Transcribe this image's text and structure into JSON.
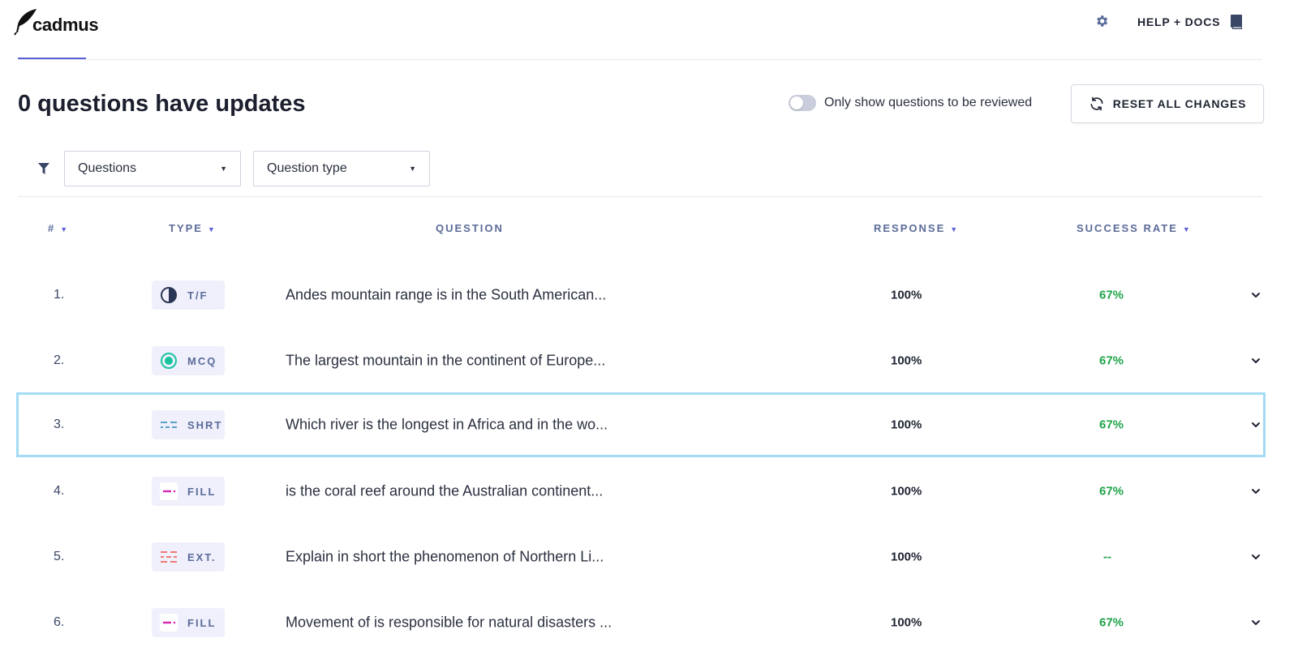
{
  "app": {
    "logo_text": "cadmus"
  },
  "header": {
    "help_label": "HELP + DOCS"
  },
  "title": "0 questions have updates",
  "toggle": {
    "label": "Only show questions to be reviewed",
    "on": false
  },
  "reset_button": {
    "label": "RESET ALL CHANGES"
  },
  "filters": {
    "questions": {
      "value": "Questions"
    },
    "question_type": {
      "value": "Question type"
    }
  },
  "columns": {
    "number": "#",
    "type": "TYPE",
    "question": "QUESTION",
    "response": "RESPONSE",
    "success_rate": "SUCCESS RATE"
  },
  "colors": {
    "accent": "#5b5fd6",
    "success": "#1fa34a",
    "selected_border": "#a4dbf5"
  },
  "rows": [
    {
      "num": "1.",
      "type": "T/F",
      "icon": "half-circle-icon",
      "question": "Andes mountain range is in the South American...",
      "response": "100%",
      "success_rate": "67%"
    },
    {
      "num": "2.",
      "type": "MCQ",
      "icon": "radio-icon",
      "question": "The largest mountain in the continent of Europe...",
      "response": "100%",
      "success_rate": "67%"
    },
    {
      "num": "3.",
      "type": "SHRT",
      "icon": "short-answer-icon",
      "question": "Which river is the longest in Africa and in the wo...",
      "response": "100%",
      "success_rate": "67%",
      "selected": true
    },
    {
      "num": "4.",
      "type": "FILL",
      "icon": "fill-blank-icon",
      "question": "is the coral reef around the Australian continent...",
      "response": "100%",
      "success_rate": "67%"
    },
    {
      "num": "5.",
      "type": "EXT.",
      "icon": "extended-answer-icon",
      "question": "Explain in short the phenomenon of Northern Li...",
      "response": "100%",
      "success_rate": "--"
    },
    {
      "num": "6.",
      "type": "FILL",
      "icon": "fill-blank-icon",
      "question": "Movement of is responsible for natural disasters ...",
      "response": "100%",
      "success_rate": "67%"
    }
  ]
}
